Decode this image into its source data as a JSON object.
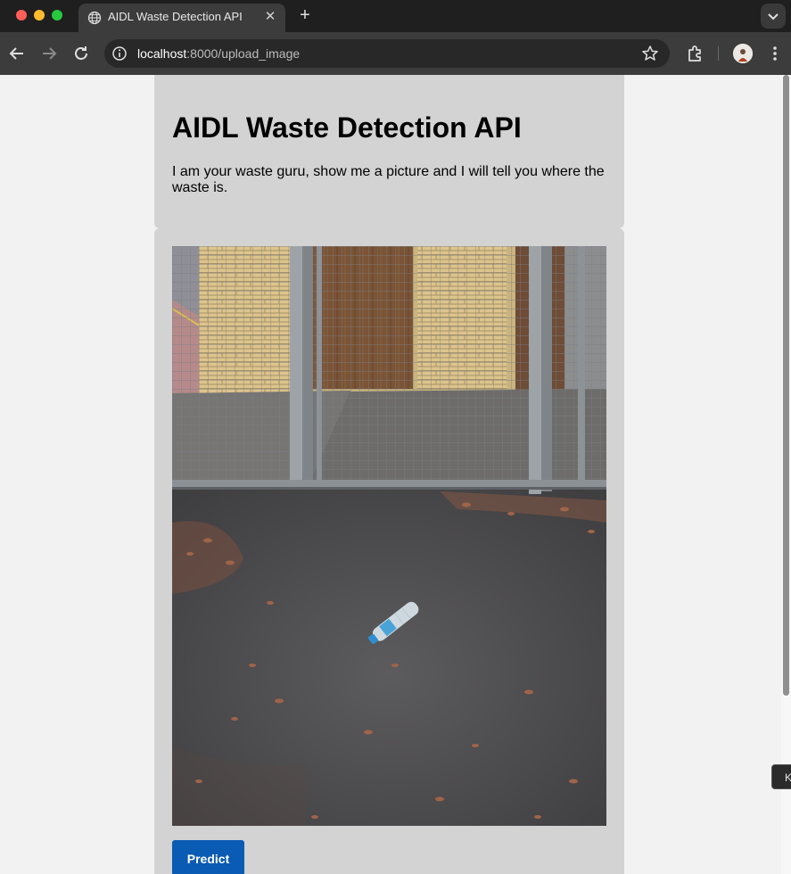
{
  "browser": {
    "tab_title": "AIDL Waste Detection API",
    "url_host": "localhost",
    "url_path": ":8000/upload_image",
    "icons": [
      "globe-icon",
      "close-icon",
      "plus-icon",
      "chevron-down-icon",
      "back-arrow-icon",
      "forward-arrow-icon",
      "reload-icon",
      "info-icon",
      "star-icon",
      "extensions-icon",
      "profile-avatar",
      "menu-dots-icon"
    ]
  },
  "page": {
    "title": "AIDL Waste Detection API",
    "description": "I am your waste guru, show me a picture and I will tell you where the waste is.",
    "predict_label": "Predict"
  },
  "corner_tooltip": {
    "text": "K"
  },
  "colors": {
    "card_background": "#d3d3d3",
    "page_background": "#f2f2f2",
    "button_blue": "#0a5bb4"
  }
}
